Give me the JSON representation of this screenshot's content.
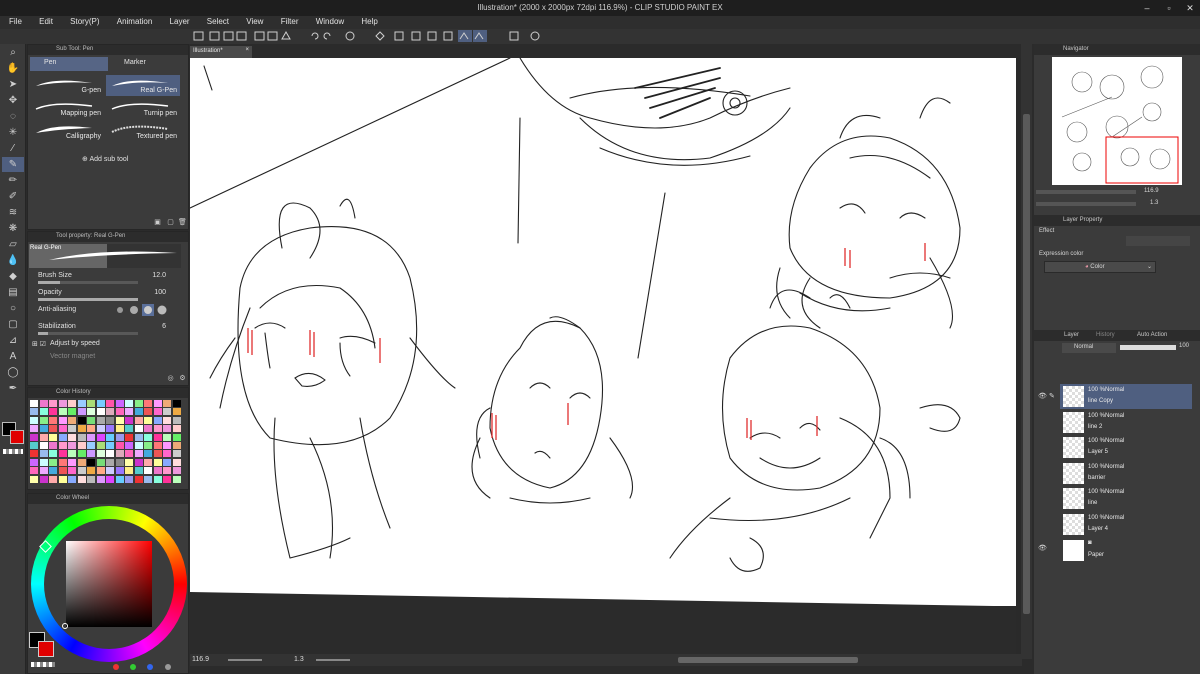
{
  "window": {
    "title": "Illustration* (2000 x 2000px 72dpi 116.9%) - CLIP STUDIO PAINT EX"
  },
  "menu": [
    "File",
    "Edit",
    "Story(P)",
    "Animation",
    "Layer",
    "Select",
    "View",
    "Filter",
    "Window",
    "Help"
  ],
  "document_tab": "Illustration*",
  "subtool_panel": {
    "header": "Sub Tool: Pen",
    "tabs": [
      "Pen",
      "Marker"
    ],
    "brushes": [
      "G-pen",
      "Real G-Pen",
      "Mapping pen",
      "Turnip pen",
      "Calligraphy",
      "Textured pen"
    ],
    "add_label": "Add sub tool"
  },
  "tool_property": {
    "header": "Tool property: Real G-Pen",
    "preset_name": "Real G-Pen",
    "brush_size_label": "Brush Size",
    "brush_size": "12.0",
    "opacity_label": "Opacity",
    "opacity": "100",
    "anti_aliasing_label": "Anti-aliasing",
    "stabilization_label": "Stabilization",
    "stabilization": "6",
    "adjust_label": "Adjust by speed",
    "vector_label": "Vector magnet"
  },
  "color_history": {
    "header": "Color History"
  },
  "color_wheel": {
    "header": "Color Wheel"
  },
  "navigator": {
    "header": "Navigator",
    "zoom": "116.9",
    "rotation": "1.3"
  },
  "layer_property": {
    "header": "Layer Property",
    "effect_label": "Effect",
    "expression_label": "Expression color",
    "expression_value": "Color"
  },
  "layer_panel": {
    "tabs": [
      "Layer",
      "History",
      "Auto Action"
    ],
    "blend_mode": "Normal",
    "opacity": "100",
    "layers": [
      {
        "pct": "100 %Normal",
        "name": "line Copy"
      },
      {
        "pct": "100 %Normal",
        "name": "line 2"
      },
      {
        "pct": "100 %Normal",
        "name": "Layer 5"
      },
      {
        "pct": "100 %Normal",
        "name": "barrier"
      },
      {
        "pct": "100 %Normal",
        "name": "line"
      },
      {
        "pct": "100 %Normal",
        "name": "Layer 4"
      }
    ],
    "paper_name": "Paper"
  },
  "statusbar": {
    "zoom": "116.9",
    "rotation": "1.3"
  },
  "colors": {
    "main_color": "#000000",
    "sub_color": "#e00000",
    "accent": "#4f5f80",
    "canvas": "#ffffff",
    "blush_red": "#e03030"
  }
}
